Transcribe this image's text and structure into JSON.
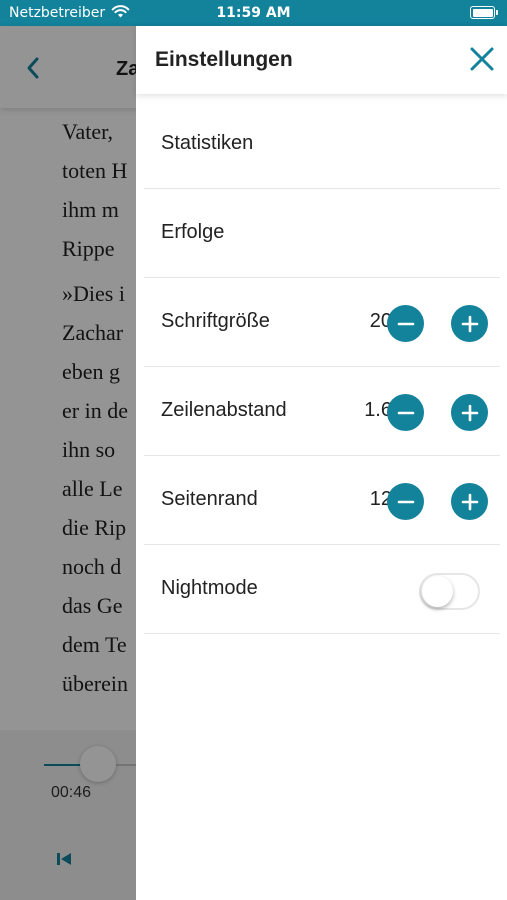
{
  "status_bar": {
    "carrier": "Netzbetreiber",
    "time": "11:59 AM",
    "wifi_icon": "wifi-icon",
    "battery_icon": "battery-icon"
  },
  "reader": {
    "title": "Za",
    "lines": [
      "Vater,",
      "toten H",
      "ihm m",
      "Rippe"
    ],
    "paragraph2": [
      "»Dies i",
      "Zachar",
      "eben g",
      "er in de",
      "ihn so",
      "alle Le",
      "die Rip",
      "noch d",
      "das Ge",
      "dem Te",
      "überein"
    ],
    "player": {
      "time": "00:46",
      "progress": 0.12
    }
  },
  "settings": {
    "title": "Einstellungen",
    "close_icon": "close-icon",
    "items": [
      {
        "label": "Statistiken"
      },
      {
        "label": "Erfolge"
      },
      {
        "label": "Schriftgröße",
        "value": "20"
      },
      {
        "label": "Zeilenabstand",
        "value": "1.6"
      },
      {
        "label": "Seitenrand",
        "value": "12"
      },
      {
        "label": "Nightmode",
        "toggle": false
      }
    ]
  },
  "colors": {
    "accent": "#13829b",
    "overlay": "rgba(0,0,0,0.42)"
  }
}
